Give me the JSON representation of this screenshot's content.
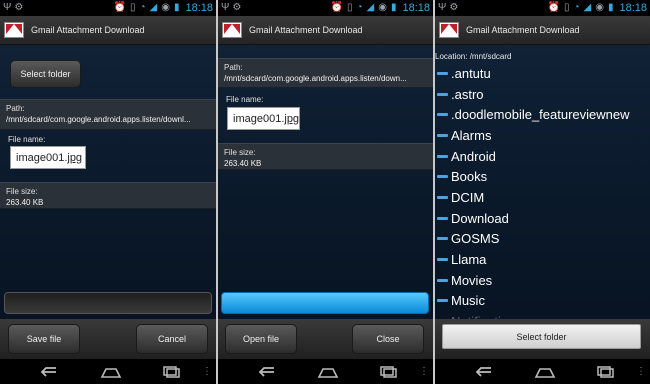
{
  "status_bar": {
    "time": "18:18"
  },
  "app_title": "Gmail Attachment Download",
  "screen1": {
    "select_folder_label": "Select folder",
    "path_label": "Path:",
    "path_value": "/mnt/sdcard/com.google.android.apps.listen/downl...",
    "file_name_label": "File name:",
    "file_name_base": "image001.",
    "file_name_ext": "jpg",
    "file_size_label": "File size:",
    "file_size_value": "263.40 KB",
    "progress": 0,
    "save_label": "Save file",
    "cancel_label": "Cancel"
  },
  "screen2": {
    "path_label": "Path:",
    "path_line1": "/mnt/sdcard/com.google.android.apps.listen",
    "path_line2": "/mnt/sdcard/com.google.android.apps.listen/down...",
    "file_name_label": "File name:",
    "file_name_base": "image001.",
    "file_name_ext": "jpg",
    "file_size_label": "File size:",
    "file_size_value": "263.40 KB",
    "progress": 1,
    "open_label": "Open file",
    "close_label": "Close"
  },
  "screen3": {
    "location_label": "Location: /mnt/sdcard",
    "folders": [
      ".antutu",
      ".astro",
      ".doodlemobile_featureviewnew",
      "Alarms",
      "Android",
      "Books",
      "DCIM",
      "Download",
      "GOSMS",
      "Llama",
      "Movies",
      "Music",
      "Notifications"
    ],
    "select_folder_label": "Select folder"
  },
  "icons": {
    "status_left": [
      "usb-icon",
      "android-debug-icon",
      "notification-icon"
    ],
    "status_right": [
      "alarm-icon",
      "vibrate-icon",
      "wifi-icon",
      "signal-icon",
      "sync-icon",
      "battery-icon"
    ],
    "nav": [
      "back-icon",
      "home-icon",
      "recent-apps-icon"
    ]
  },
  "colors": {
    "accent": "#35a8e0",
    "progress_blue": "#1a9ae8",
    "app_icon_red": "#c0202a"
  }
}
